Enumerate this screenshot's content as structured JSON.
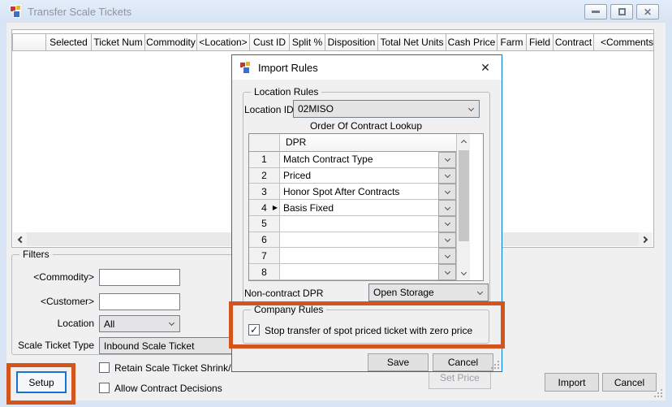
{
  "window": {
    "title": "Transfer Scale Tickets",
    "close_glyph": "✕"
  },
  "ticket_grid": {
    "columns": [
      "",
      "Selected",
      "Ticket Num",
      "Commodity",
      "<Location>",
      "Cust ID",
      "Split %",
      "Disposition",
      "Total Net Units",
      "Cash Price",
      "Farm",
      "Field",
      "Contract",
      "<Comments>"
    ]
  },
  "filters": {
    "group_label": "Filters",
    "commodity_label": "<Commodity>",
    "commodity_value": "",
    "customer_label": "<Customer>",
    "customer_value": "",
    "location_label": "Location",
    "location_value": "All",
    "ticket_type_label": "Scale Ticket Type",
    "ticket_type_value": "Inbound Scale Ticket",
    "retain_checkbox_label": "Retain Scale Ticket Shrink/D",
    "retain_checked": false,
    "allow_checkbox_label": "Allow Contract Decisions",
    "allow_checked": false
  },
  "buttons": {
    "setup": "Setup",
    "set_price": "Set Price",
    "import": "Import",
    "cancel": "Cancel"
  },
  "dialog": {
    "title": "Import Rules",
    "close_glyph": "✕",
    "location_rules": {
      "group_label": "Location Rules",
      "location_id_label": "Location ID",
      "location_id_value": "02MISO",
      "lookup_title": "Order Of Contract Lookup",
      "lookup_column": "DPR",
      "rows": [
        {
          "num": "1",
          "value": "Match Contract Type",
          "current": false
        },
        {
          "num": "2",
          "value": "Priced",
          "current": false
        },
        {
          "num": "3",
          "value": "Honor Spot After Contracts",
          "current": false
        },
        {
          "num": "4",
          "value": "Basis Fixed",
          "current": true
        },
        {
          "num": "5",
          "value": "",
          "current": false
        },
        {
          "num": "6",
          "value": "",
          "current": false
        },
        {
          "num": "7",
          "value": "",
          "current": false
        },
        {
          "num": "8",
          "value": "",
          "current": false
        }
      ],
      "non_contract_label": "Non-contract DPR",
      "non_contract_value": "Open Storage"
    },
    "company_rules": {
      "group_label": "Company Rules",
      "stop_transfer_label": "Stop transfer of spot priced ticket with zero price",
      "stop_transfer_checked": true
    },
    "save_label": "Save",
    "cancel_label": "Cancel"
  },
  "colors": {
    "highlight_orange": "#d4551c",
    "dialog_border_blue": "#0079d8",
    "setup_focus_blue": "#1673d1"
  }
}
